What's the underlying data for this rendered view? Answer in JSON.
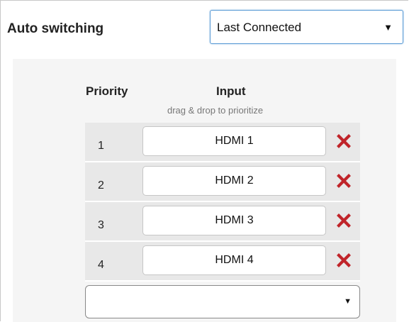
{
  "header": {
    "label": "Auto switching",
    "mode_select": {
      "value": "Last Connected",
      "arrow_icon": "dropdown-arrow-icon"
    }
  },
  "priority_table": {
    "columns": {
      "priority": "Priority",
      "input": "Input",
      "hint": "drag & drop to prioritize"
    },
    "rows": [
      {
        "priority": "1",
        "input": "HDMI 1"
      },
      {
        "priority": "2",
        "input": "HDMI 2"
      },
      {
        "priority": "3",
        "input": "HDMI 3"
      },
      {
        "priority": "4",
        "input": "HDMI 4"
      }
    ],
    "remove_icon": "remove-x-icon",
    "remove_color": "#c0242a"
  },
  "add_select": {
    "value": "",
    "arrow_icon": "dropdown-arrow-icon"
  },
  "colors": {
    "select_focus_border": "#5b9bd5",
    "panel_background": "#f5f5f5",
    "row_background": "#e8e8e8"
  }
}
